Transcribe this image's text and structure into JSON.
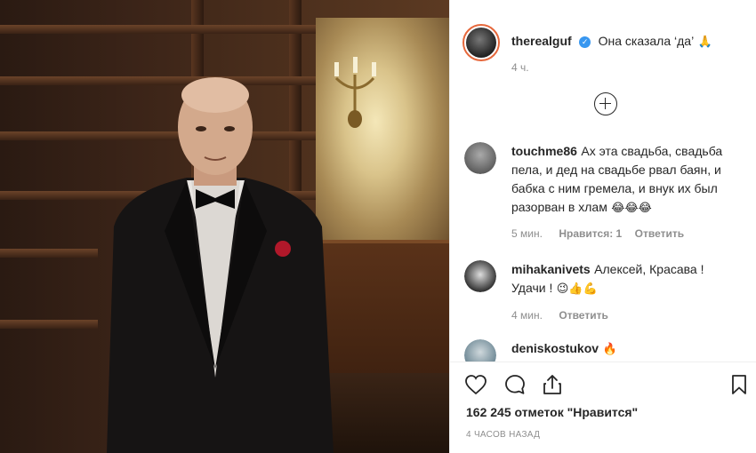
{
  "post": {
    "author": "therealguf",
    "caption": "Она сказала ‘да’",
    "caption_emoji": "🙏",
    "time": "4 ч.",
    "likes": "162 245 отметок \"Нравится\"",
    "timestamp": "4 ЧАСОВ НАЗАД"
  },
  "comments": [
    {
      "user": "touchme86",
      "text": "Ах эта свадьба, свадьба пела, и дед на свадьбе рвал баян, и бабка с ним гремела, и внук их был разорван в хлам",
      "emoji": "😂😂😂",
      "time": "5 мин.",
      "likes": "Нравится: 1",
      "reply": "Ответить"
    },
    {
      "user": "mihakanivets",
      "text": "Алексей, Красава ! Удачи !",
      "emoji": "😉👍💪",
      "time": "4 мин.",
      "likes": "",
      "reply": "Ответить"
    },
    {
      "user": "deniskostukov",
      "text": "",
      "emoji": "🔥",
      "time": "",
      "likes": "",
      "reply": ""
    }
  ],
  "colors": {
    "accent": "#3897f0",
    "muted": "#8e8e8e",
    "text": "#262626",
    "ring": "#e6683c"
  },
  "icons": {
    "like": "heart-icon",
    "comment": "comment-icon",
    "share": "share-icon",
    "save": "bookmark-icon",
    "load_more": "plus-circle-icon",
    "verified": "verified-badge-icon"
  }
}
